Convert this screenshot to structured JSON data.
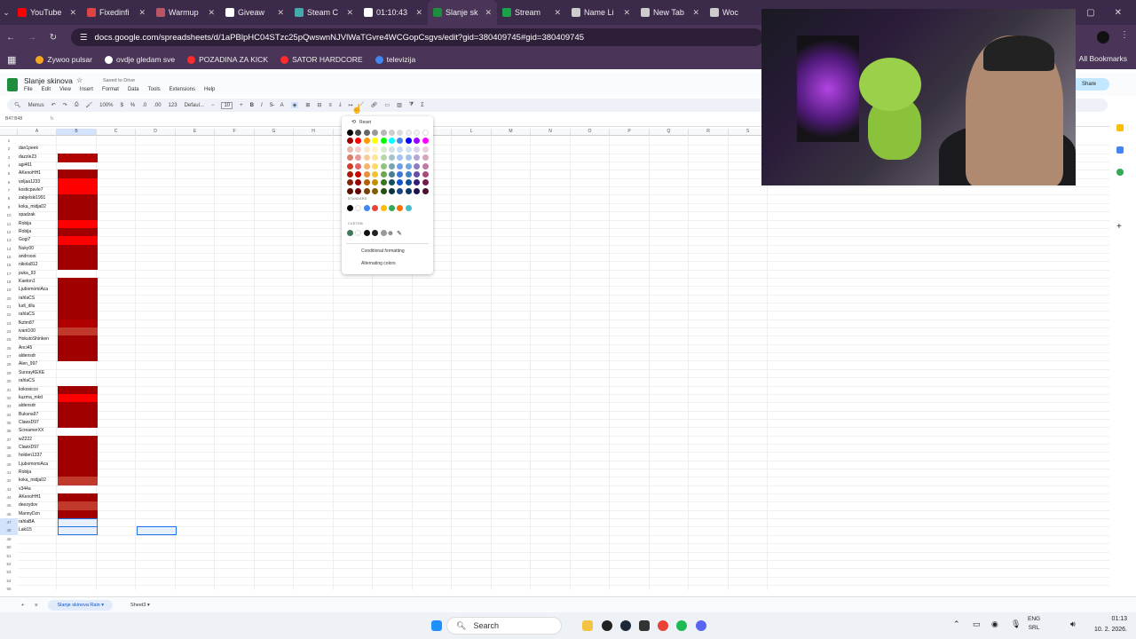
{
  "browser": {
    "tabs": [
      {
        "label": "YouTube",
        "color": "#ff0000"
      },
      {
        "label": "Fixedinfi",
        "color": "#d44"
      },
      {
        "label": "Warmup",
        "color": "#b56"
      },
      {
        "label": "Giveaw",
        "color": "#fff"
      },
      {
        "label": "Steam C",
        "color": "#4aa"
      },
      {
        "label": "01:10:43",
        "color": "#fff"
      },
      {
        "label": "Slanje sk",
        "color": "#1e8e3e"
      },
      {
        "label": "Stream",
        "color": "#1aa34a"
      },
      {
        "label": "Name Li",
        "color": "#ccc"
      },
      {
        "label": "New Tab",
        "color": "#ccc"
      },
      {
        "label": "Woc",
        "color": "#ccc"
      }
    ],
    "url": "docs.google.com/spreadsheets/d/1aPBlpHC04STzc25pQwswnNJVlWaTGvre4WCGopCsgvs/edit?gid=380409745#gid=380409745",
    "bookmarks": [
      {
        "label": "Zywoo pulsar",
        "color": "#f5a623"
      },
      {
        "label": "ovdje gledam sve",
        "color": "#fff"
      },
      {
        "label": "POZADINA ZA KICK",
        "color": "#ff2a2a"
      },
      {
        "label": "SATOR HARDCORE",
        "color": "#ff2a2a"
      },
      {
        "label": "televizija",
        "color": "#4285f4"
      }
    ],
    "all_bookmarks": "All Bookmarks"
  },
  "doc": {
    "title": "Slanje skinova",
    "saved": "Saved to Drive",
    "menus": [
      "File",
      "Edit",
      "View",
      "Insert",
      "Format",
      "Data",
      "Tools",
      "Extensions",
      "Help"
    ],
    "share": "Share"
  },
  "toolbar": {
    "menus": "Menus",
    "zoom": "100%",
    "currency": "$",
    "percent": "%",
    "dec1": ".0",
    "dec2": ".00",
    "num": "123",
    "font": "Defaul...",
    "size": "10",
    "bold": "B",
    "italic": "I",
    "sum": "Σ"
  },
  "name_box": "B47:B48",
  "columns": [
    "A",
    "B",
    "C",
    "D",
    "E",
    "F",
    "G",
    "H",
    "I",
    "J",
    "K",
    "L",
    "M",
    "N",
    "O",
    "P",
    "Q",
    "R",
    "S"
  ],
  "rows": [
    {
      "n": "1",
      "a": "",
      "fill": ""
    },
    {
      "n": "2",
      "a": "dan1peek",
      "fill": ""
    },
    {
      "n": "3",
      "a": "dazzle23",
      "fill": "#b00000"
    },
    {
      "n": "4",
      "a": "agi461",
      "fill": ""
    },
    {
      "n": "5",
      "a": "AKenoHH1",
      "fill": "#a00000"
    },
    {
      "n": "6",
      "a": "veljaa1233",
      "fill": "#ff0000"
    },
    {
      "n": "7",
      "a": "kosticpavle7",
      "fill": "#ff0000"
    },
    {
      "n": "8",
      "a": "zabjelski1991",
      "fill": "#a00000"
    },
    {
      "n": "9",
      "a": "koka_midja02",
      "fill": "#a00000"
    },
    {
      "n": "10",
      "a": "spadzak",
      "fill": "#a00000"
    },
    {
      "n": "11",
      "a": "Robija",
      "fill": "#ff0000"
    },
    {
      "n": "12",
      "a": "Robija",
      "fill": "#a00000"
    },
    {
      "n": "13",
      "a": "Gogi7",
      "fill": "#ff0000"
    },
    {
      "n": "14",
      "a": "Nuky00",
      "fill": "#a00000"
    },
    {
      "n": "15",
      "a": "androooi",
      "fill": "#a00000"
    },
    {
      "n": "16",
      "a": "nikola812",
      "fill": "#a00000"
    },
    {
      "n": "17",
      "a": "puka_93",
      "fill": ""
    },
    {
      "n": "18",
      "a": "Kaeton1",
      "fill": "#a00000"
    },
    {
      "n": "19",
      "a": "LjubomomiAca",
      "fill": "#a00000"
    },
    {
      "n": "20",
      "a": "rahlaCS",
      "fill": "#a00000"
    },
    {
      "n": "21",
      "a": "ludi_dilu",
      "fill": "#a00000"
    },
    {
      "n": "22",
      "a": "rahlaCS",
      "fill": "#a00000"
    },
    {
      "n": "23",
      "a": "fkztm87",
      "fill": "#b00000"
    },
    {
      "n": "24",
      "a": "ivant100",
      "fill": "#c0392b"
    },
    {
      "n": "25",
      "a": "HokutoShinken",
      "fill": "#a00000"
    },
    {
      "n": "26",
      "a": "Anci45",
      "fill": "#a00000"
    },
    {
      "n": "27",
      "a": "aldensdr",
      "fill": "#a00000"
    },
    {
      "n": "28",
      "a": "Alen_997",
      "fill": ""
    },
    {
      "n": "29",
      "a": "SunrayKEKE",
      "fill": ""
    },
    {
      "n": "30",
      "a": "rahlaCS",
      "fill": ""
    },
    {
      "n": "31",
      "a": "kokosicco",
      "fill": "#a00000"
    },
    {
      "n": "32",
      "a": "kuzma_mkd",
      "fill": "#ff0000"
    },
    {
      "n": "33",
      "a": "aldensdr",
      "fill": "#a00000"
    },
    {
      "n": "34",
      "a": "Buksna97",
      "fill": "#a00000"
    },
    {
      "n": "35",
      "a": "ClawxD97",
      "fill": "#a00000"
    },
    {
      "n": "36",
      "a": "ScreamerXX",
      "fill": ""
    },
    {
      "n": "37",
      "a": "wZ222",
      "fill": "#a00000"
    },
    {
      "n": "38",
      "a": "ClawxD97",
      "fill": "#a00000"
    },
    {
      "n": "39",
      "a": "holden1337",
      "fill": "#a00000"
    },
    {
      "n": "40",
      "a": "LjubomomiAca",
      "fill": "#a00000"
    },
    {
      "n": "41",
      "a": "Robija",
      "fill": "#a00000"
    },
    {
      "n": "42",
      "a": "koka_midja02",
      "fill": "#c0392b"
    },
    {
      "n": "43",
      "a": "v344a",
      "fill": ""
    },
    {
      "n": "44",
      "a": "AKenoHH1",
      "fill": "#a00000"
    },
    {
      "n": "45",
      "a": "deezydov",
      "fill": "#c0392b"
    },
    {
      "n": "46",
      "a": "MannyDzn",
      "fill": "#a00000"
    },
    {
      "n": "47",
      "a": "rahlaBA",
      "fill": "sel"
    },
    {
      "n": "48",
      "a": "Laki15",
      "fill": "sel"
    },
    {
      "n": "49",
      "a": "",
      "fill": ""
    },
    {
      "n": "50",
      "a": "",
      "fill": ""
    },
    {
      "n": "51",
      "a": "",
      "fill": ""
    },
    {
      "n": "52",
      "a": "",
      "fill": ""
    },
    {
      "n": "53",
      "a": "",
      "fill": ""
    },
    {
      "n": "54",
      "a": "",
      "fill": ""
    },
    {
      "n": "55",
      "a": "",
      "fill": ""
    }
  ],
  "palette": {
    "reset": "Reset",
    "standard": "STANDARD",
    "custom": "CUSTOM",
    "conditional": "Conditional formatting",
    "alternating": "Alternating colors",
    "grid_colors": [
      [
        "#000000",
        "#434343",
        "#666666",
        "#999999",
        "#b7b7b7",
        "#cccccc",
        "#d9d9d9",
        "#efefef",
        "#f3f3f3",
        "#ffffff"
      ],
      [
        "#980000",
        "#ff0000",
        "#ff9900",
        "#ffff00",
        "#00ff00",
        "#00ffff",
        "#4a86e8",
        "#0000ff",
        "#9900ff",
        "#ff00ff"
      ],
      [
        "#e6b8af",
        "#f4cccc",
        "#fce5cd",
        "#fff2cc",
        "#d9ead3",
        "#d0e0e3",
        "#c9daf8",
        "#cfe2f3",
        "#d9d2e9",
        "#ead1dc"
      ],
      [
        "#dd7e6b",
        "#ea9999",
        "#f9cb9c",
        "#ffe599",
        "#b6d7a8",
        "#a2c4c9",
        "#a4c2f4",
        "#9fc5e8",
        "#b4a7d6",
        "#d5a6bd"
      ],
      [
        "#cc4125",
        "#e06666",
        "#f6b26b",
        "#ffd966",
        "#93c47d",
        "#76a5af",
        "#6d9eeb",
        "#6fa8dc",
        "#8e7cc3",
        "#c27ba0"
      ],
      [
        "#a61c00",
        "#cc0000",
        "#e69138",
        "#f1c232",
        "#6aa84f",
        "#45818e",
        "#3c78d8",
        "#3d85c6",
        "#674ea7",
        "#a64d79"
      ],
      [
        "#85200c",
        "#990000",
        "#b45f06",
        "#bf9000",
        "#38761d",
        "#134f5c",
        "#1155cc",
        "#0b5394",
        "#351c75",
        "#741b47"
      ],
      [
        "#5b0f00",
        "#660000",
        "#783f04",
        "#7f6000",
        "#274e13",
        "#0c343d",
        "#1c4587",
        "#073763",
        "#20124d",
        "#4c1130"
      ]
    ],
    "standard_colors": [
      "#000000",
      "#ffffff",
      "#4285f4",
      "#ea4335",
      "#fbbc04",
      "#34a853",
      "#ff6d01",
      "#46bdc6"
    ],
    "custom_colors": [
      "#3d7a5a",
      "#ffffff",
      "#111111",
      "#222222",
      "#999999"
    ]
  },
  "sheets": [
    {
      "label": "Slanje skinova Rain",
      "active": true
    },
    {
      "label": "Sheet3",
      "active": false
    }
  ],
  "taskbar": {
    "search": "Search",
    "lang1": "ENG",
    "lang2": "SRL",
    "time": "01:13",
    "date": "10. 2. 2026."
  }
}
